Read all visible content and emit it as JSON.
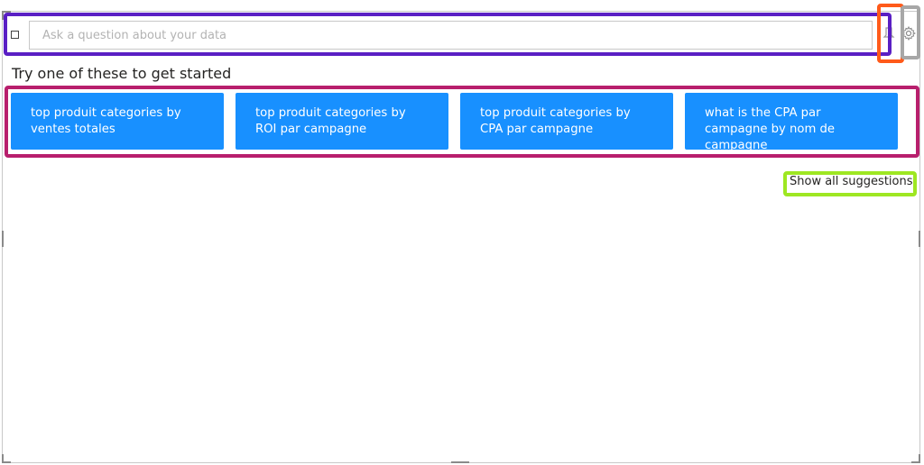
{
  "search": {
    "placeholder": "Ask a question about your data",
    "value": ""
  },
  "suggestions": {
    "heading": "Try one of these to get started",
    "items": [
      {
        "label": "top produit categories by ventes totales"
      },
      {
        "label": "top produit categories by ROI par campagne"
      },
      {
        "label": "top produit categories by CPA par campagne"
      },
      {
        "label": "what is the CPA par campagne by nom de campagne"
      }
    ],
    "show_all_label": "Show all suggestions"
  },
  "icons": {
    "pin": "pin-icon",
    "settings": "gear-icon"
  },
  "colors": {
    "chip_bg": "#1890ff",
    "annotation_purple": "#5a1fc4",
    "annotation_orange": "#ff5a1a",
    "annotation_gray": "#a7a7a7",
    "annotation_magenta": "#b81f6d",
    "annotation_green": "#9ee722"
  }
}
